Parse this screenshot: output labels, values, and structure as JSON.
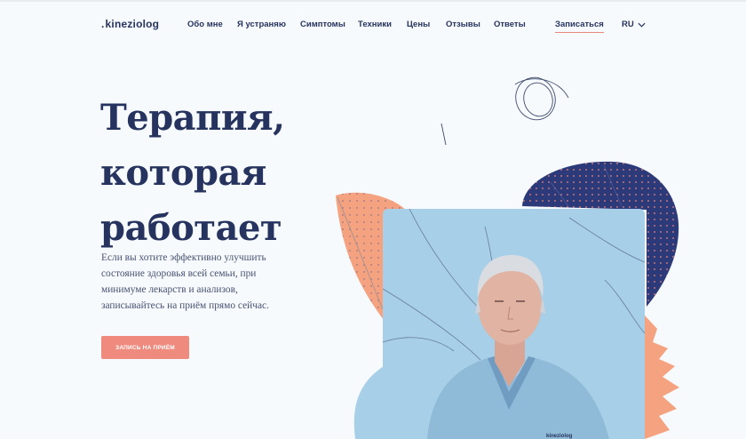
{
  "header": {
    "logo": "kineziolog",
    "logo_dot": ".",
    "nav": [
      "Обо мне",
      "Я устраняю",
      "Симптомы",
      "Техники",
      "Цены",
      "Отзывы",
      "Ответы"
    ],
    "signup_link": "Записаться",
    "language": "RU"
  },
  "hero": {
    "title_lines": [
      "Терапия,",
      "которая",
      "работает"
    ],
    "text_lines": [
      "Если вы хотите эффективно улучшить",
      "состояние здоровья всей семьи, при",
      "минимуме лекарств и анализов,",
      "записывайтесь на приём прямо сейчас."
    ],
    "cta_label": "Запись на приём"
  },
  "photo": {
    "badge_text": "kineziolog"
  },
  "colors": {
    "navy": "#26335e",
    "coral": "#ee8a7e",
    "peach": "#f4a27f",
    "photo_bg": "#a8cfe8",
    "blob_navy": "#2c3a7a"
  }
}
